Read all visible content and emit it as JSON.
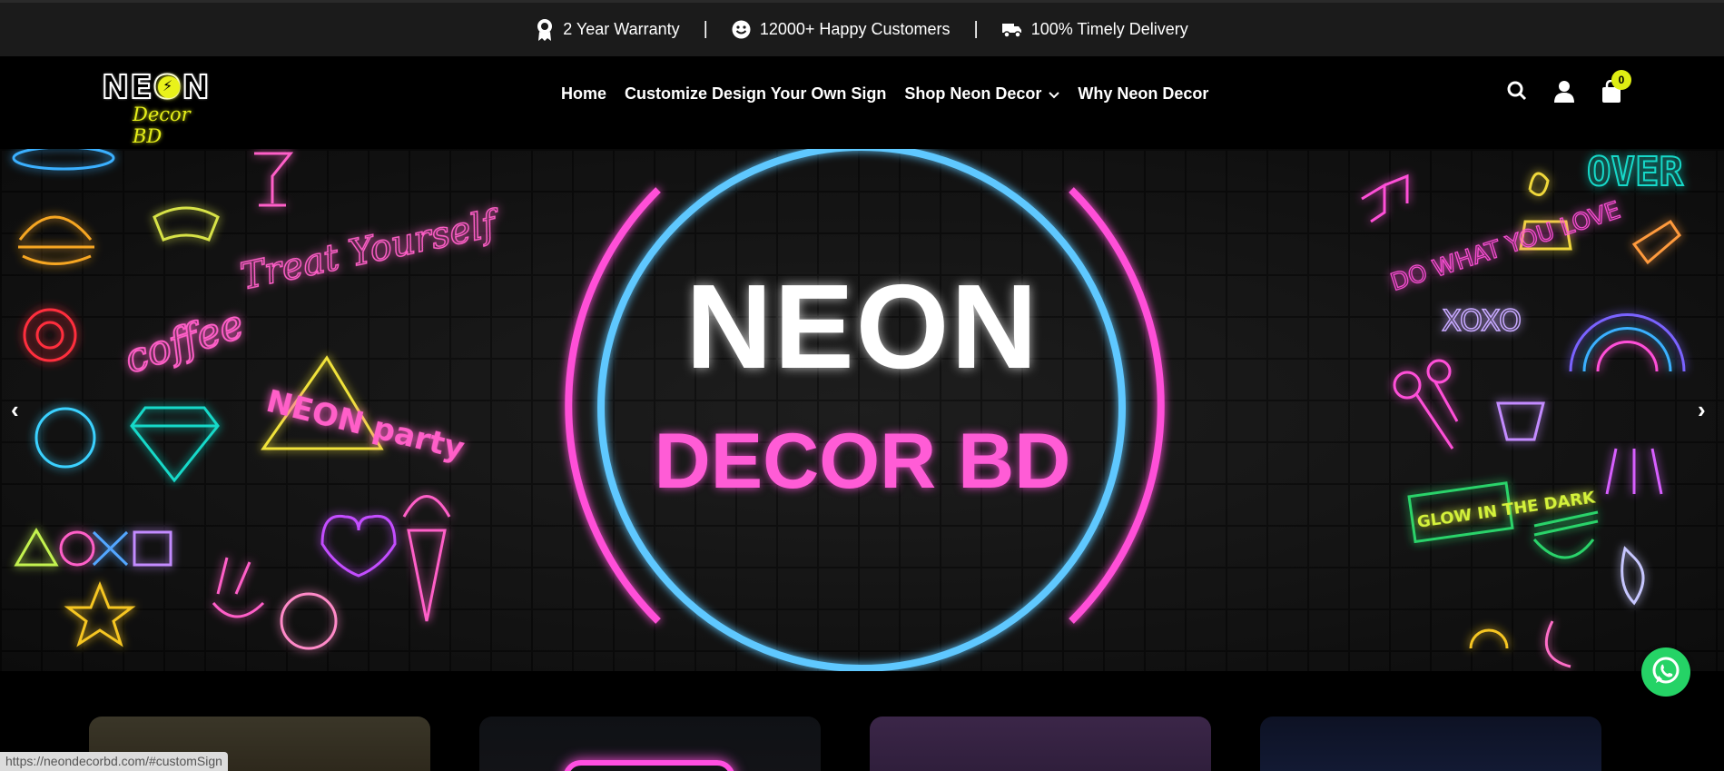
{
  "topbar": {
    "items": [
      {
        "icon": "award-icon",
        "label": "2 Year Warranty"
      },
      {
        "icon": "smile-icon",
        "label": "12000+ Happy Customers"
      },
      {
        "icon": "truck-icon",
        "label": "100% Timely Delivery"
      }
    ],
    "separator": "|"
  },
  "header": {
    "logo": {
      "top": "NEON",
      "sub": "Decor BD"
    },
    "nav": [
      {
        "label": "Home"
      },
      {
        "label": "Customize Design Your Own Sign"
      },
      {
        "label": "Shop Neon Decor",
        "has_dropdown": true
      },
      {
        "label": "Why Neon Decor"
      }
    ],
    "actions": {
      "search_icon": "search-icon",
      "account_icon": "user-icon",
      "cart_icon": "bag-icon",
      "cart_count": "0"
    }
  },
  "hero": {
    "title": "NEON",
    "subtitle": "DECOR BD",
    "prev": "‹",
    "next": "›",
    "left_signs": [
      "Treat Yourself",
      "coffee",
      "NEON party"
    ],
    "right_signs": [
      "OVER",
      "DO WHAT YOU LOVE",
      "XOXO",
      "GLOW IN THE DARK"
    ],
    "colors": {
      "ring_blue": "#5ec8ff",
      "ring_pink": "#ff4fd8",
      "title_pink": "#ff5cd6"
    }
  },
  "status_bar": {
    "url": "https://neondecorbd.com/#customSign"
  },
  "whatsapp": {
    "icon": "whatsapp-icon"
  }
}
